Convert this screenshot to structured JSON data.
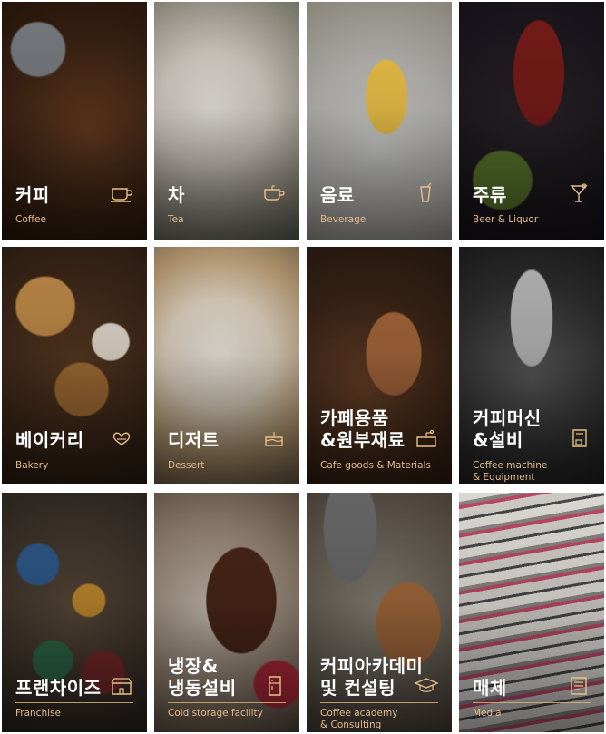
{
  "categories": [
    {
      "title": "커피",
      "subtitle": "Coffee",
      "icon": "coffee-cup-icon"
    },
    {
      "title": "차",
      "subtitle": "Tea",
      "icon": "tea-cup-icon"
    },
    {
      "title": "음료",
      "subtitle": "Beverage",
      "icon": "juice-glass-icon"
    },
    {
      "title": "주류",
      "subtitle": "Beer & Liquor",
      "icon": "cocktail-glass-icon"
    },
    {
      "title": "베이커리",
      "subtitle": "Bakery",
      "icon": "pretzel-icon"
    },
    {
      "title": "디저트",
      "subtitle": "Dessert",
      "icon": "cake-icon"
    },
    {
      "title": "카페용품\n&원부재료",
      "subtitle": "Cafe goods & Materials",
      "icon": "grinder-icon"
    },
    {
      "title": "커피머신\n&설비",
      "subtitle": "Coffee machine\n& Equipment",
      "icon": "coffee-machine-icon"
    },
    {
      "title": "프랜차이즈",
      "subtitle": "Franchise",
      "icon": "cafe-store-icon"
    },
    {
      "title": "냉장&\n냉동설비",
      "subtitle": "Cold storage facility",
      "icon": "refrigerator-icon"
    },
    {
      "title": "커피아카데미\n및 컨설팅",
      "subtitle": "Coffee academy\n& Consulting",
      "icon": "graduation-cap-icon"
    },
    {
      "title": "매체",
      "subtitle": "Media",
      "icon": "magazine-icon"
    }
  ]
}
